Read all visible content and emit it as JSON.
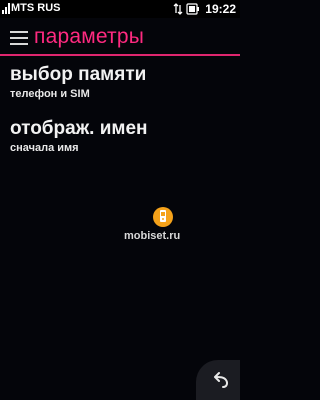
{
  "status_bar": {
    "carrier": "MTS RUS",
    "time": "19:22",
    "icons": [
      "signal-icon",
      "data-arrows-icon",
      "battery-icon"
    ]
  },
  "header": {
    "title": "параметры",
    "menu_icon": "hamburger-icon"
  },
  "settings": [
    {
      "title": "выбор памяти",
      "value": "телефон и SIM"
    },
    {
      "title": "отображ. имен",
      "value": "сначала имя"
    }
  ],
  "watermark": {
    "text": "mobiset.ru"
  },
  "navigation": {
    "back_icon": "back-arrow-icon"
  },
  "colors": {
    "accent": "#ff2a80",
    "background": "#04050a"
  }
}
